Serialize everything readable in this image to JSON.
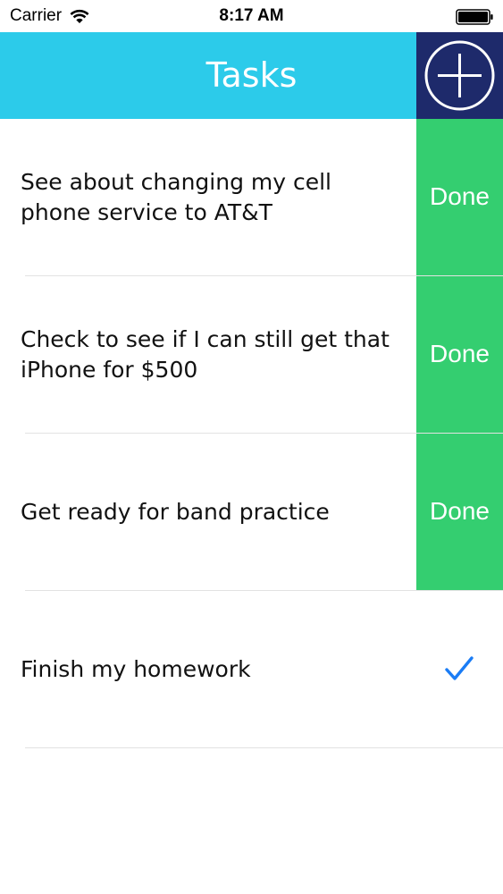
{
  "status_bar": {
    "carrier": "Carrier",
    "time": "8:17 AM",
    "wifi_icon": "wifi-icon",
    "battery_icon": "battery-icon"
  },
  "nav_bar": {
    "title": "Tasks",
    "background": "#2ccbea",
    "add_icon": "plus-circle-icon",
    "add_background": "#1e2a6b"
  },
  "colors": {
    "done_green": "#34ce70",
    "check_blue": "#1a7cf5"
  },
  "tasks": [
    {
      "text": "See about changing my cell phone service to AT&T",
      "action": "Done",
      "completed": false
    },
    {
      "text": "Check to see if I can still get that iPhone for $500",
      "action": "Done",
      "completed": false
    },
    {
      "text": "Get ready for band practice",
      "action": "Done",
      "completed": false
    },
    {
      "text": "Finish my homework",
      "action": "",
      "completed": true
    }
  ]
}
